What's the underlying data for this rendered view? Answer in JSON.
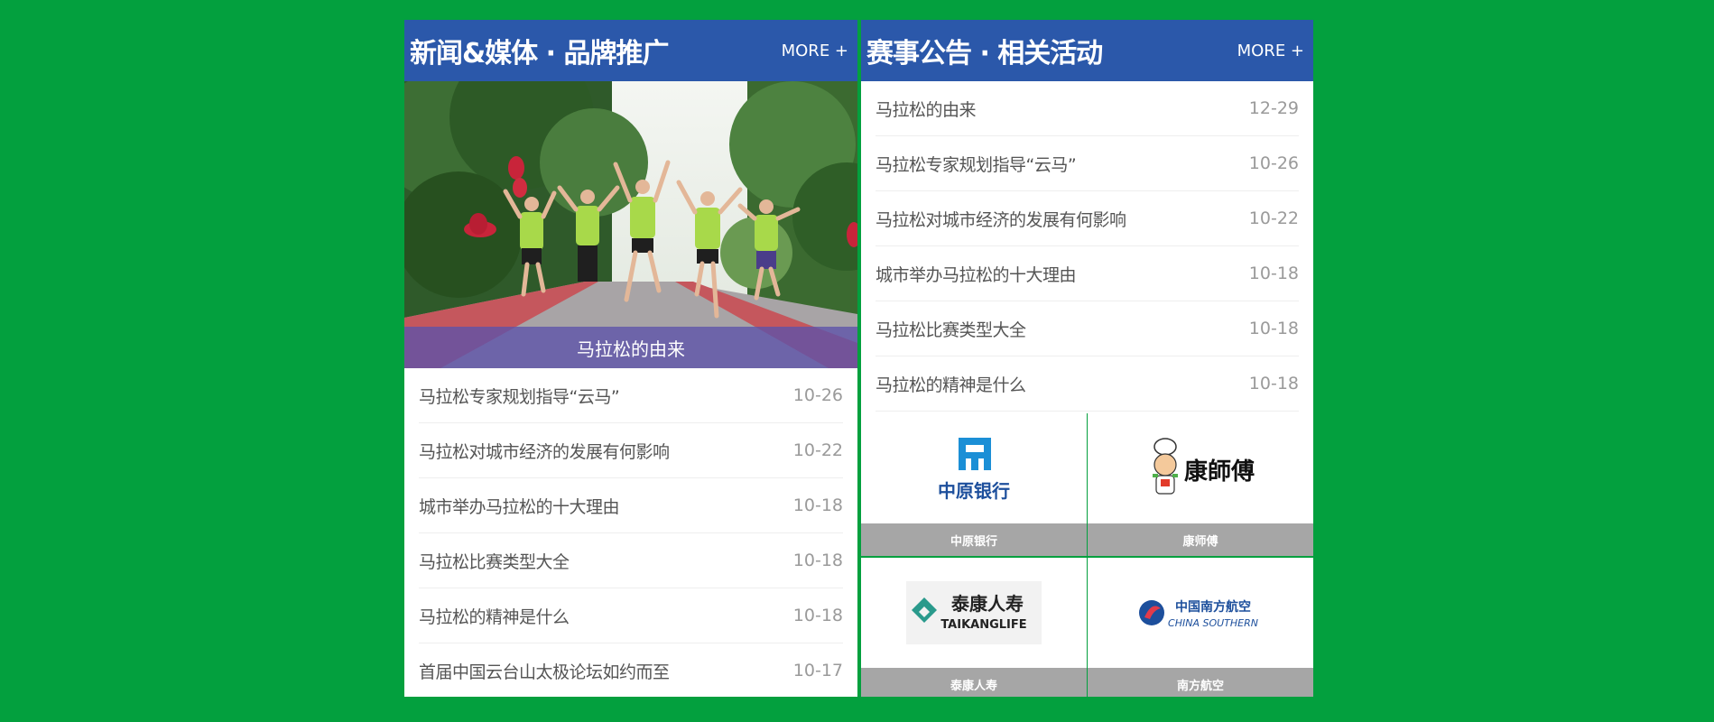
{
  "left_panel": {
    "title": "新闻&媒体 · 品牌推广",
    "more": "MORE +",
    "featured_caption": "马拉松的由来",
    "items": [
      {
        "title": "马拉松专家规划指导“云马”",
        "date": "10-26"
      },
      {
        "title": "马拉松对城市经济的发展有何影响",
        "date": "10-22"
      },
      {
        "title": "城市举办马拉松的十大理由",
        "date": "10-18"
      },
      {
        "title": "马拉松比赛类型大全",
        "date": "10-18"
      },
      {
        "title": "马拉松的精神是什么",
        "date": "10-18"
      },
      {
        "title": "首届中国云台山太极论坛如约而至",
        "date": "10-17"
      }
    ]
  },
  "right_panel": {
    "title": "赛事公告 · 相关活动",
    "more": "MORE +",
    "items": [
      {
        "title": "马拉松的由来",
        "date": "12-29"
      },
      {
        "title": "马拉松专家规划指导“云马”",
        "date": "10-26"
      },
      {
        "title": "马拉松对城市经济的发展有何影响",
        "date": "10-22"
      },
      {
        "title": "城市举办马拉松的十大理由",
        "date": "10-18"
      },
      {
        "title": "马拉松比赛类型大全",
        "date": "10-18"
      },
      {
        "title": "马拉松的精神是什么",
        "date": "10-18"
      }
    ],
    "sponsors": [
      {
        "name": "中原银行",
        "logo_text": "中原银行",
        "icon": "zhongyuan-bank-logo"
      },
      {
        "name": "康师傅",
        "logo_text": "康師傅",
        "icon": "kangshifu-logo"
      },
      {
        "name": "泰康人寿",
        "logo_text": "泰康人寿",
        "logo_sub": "TAIKANGLIFE",
        "icon": "taikang-life-logo"
      },
      {
        "name": "南方航空",
        "logo_text": "中国南方航空",
        "logo_sub": "CHINA SOUTHERN",
        "icon": "china-southern-logo"
      }
    ]
  },
  "colors": {
    "background": "#03a03e",
    "header": "#2b58aa",
    "caption_overlay": "#5c52aa",
    "sponsor_label": "#a6a6a6",
    "date_text": "#9a9a9a"
  }
}
